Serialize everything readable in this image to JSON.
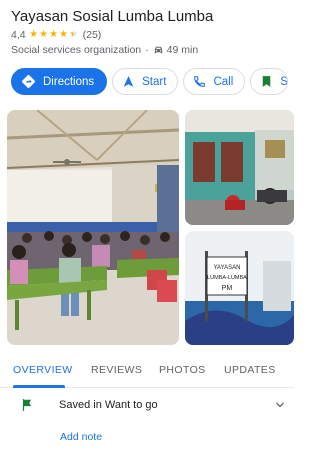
{
  "place": {
    "name": "Yayasan Sosial Lumba Lumba",
    "rating": "4,4",
    "rating_fraction": 0.88,
    "review_count": "(25)",
    "category": "Social services organization",
    "separator": "·",
    "drive_time": "49 min"
  },
  "actions": [
    {
      "label": "Directions",
      "icon": "directions-icon"
    },
    {
      "label": "Start",
      "icon": "navigation-arrow-icon"
    },
    {
      "label": "Call",
      "icon": "phone-icon"
    },
    {
      "label": "S",
      "icon": "bookmark-icon"
    }
  ],
  "photos": {
    "sign_text_1": "YAYASAN",
    "sign_text_2": "LUMBA-LUMBA",
    "sign_text_3": "PM"
  },
  "tabs": [
    "OVERVIEW",
    "REVIEWS",
    "PHOTOS",
    "UPDATES"
  ],
  "saved": {
    "text": "Saved in Want to go",
    "add_note": "Add note"
  },
  "colors": {
    "accent": "#1a73e8",
    "star": "#f4b400",
    "saved_flag": "#188038"
  }
}
